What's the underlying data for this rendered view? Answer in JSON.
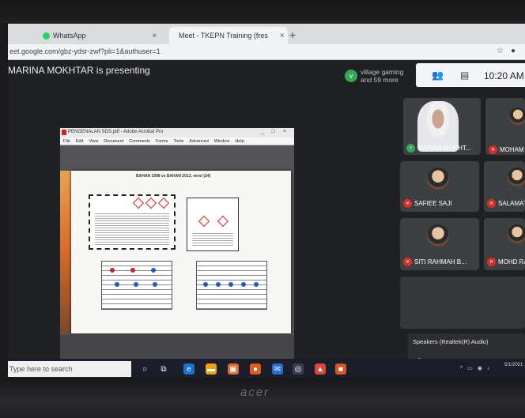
{
  "browser": {
    "tabs": [
      {
        "label": "WhatsApp",
        "active": false
      },
      {
        "label": "Meet - TKEPN Training (fres",
        "active": true
      }
    ],
    "new_tab": "+",
    "url": "eet.google.com/gbz-ydsr-zwf?pli=1&authuser=1"
  },
  "meet": {
    "presenting_text": "MARINA MOKHTAR is presenting",
    "avatar_initial": "v",
    "others_text": "village gaming and 59 more",
    "clock": "10:20 AM",
    "participants": [
      {
        "name": "MARINA MOKHT...",
        "video": true
      },
      {
        "name": "MOHAM"
      },
      {
        "name": "SAFIEE SAJI"
      },
      {
        "name": "SALAMAT"
      },
      {
        "name": "SITI RAHMAH B..."
      },
      {
        "name": "MOHD RAZ"
      }
    ],
    "speakers": {
      "label": "Speakers (Realtek(R) Audio)",
      "volume_fraction": 0.75
    }
  },
  "pdf": {
    "window_title": "PENGENALAN SDS.pdf - Adobe Acrobat Pro",
    "menu": [
      "File",
      "Edit",
      "View",
      "Document",
      "Comments",
      "Forms",
      "Tools",
      "Advanced",
      "Window",
      "Help"
    ],
    "page_heading": "BAHAN 1998 vs BAHAN 2013, versi (24)"
  },
  "taskbar": {
    "search_placeholder": "Type here to search",
    "date": "5/1/2021"
  },
  "laptop": {
    "brand": "acer"
  },
  "colors": {
    "meet_bg": "#202124",
    "mute_red": "#d93025",
    "accent_green": "#34a853",
    "taskbar": "#1b1d2a"
  }
}
